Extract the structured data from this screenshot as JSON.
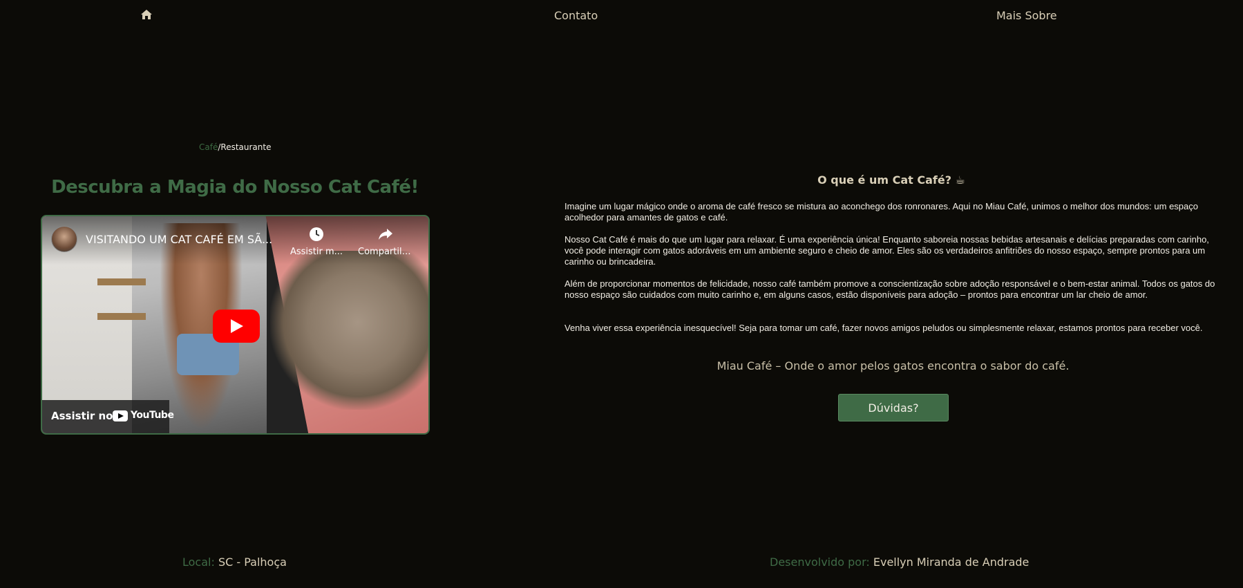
{
  "nav": {
    "home_icon": "home-icon",
    "contato": "Contato",
    "mais_sobre": "Mais Sobre"
  },
  "breadcrumb": {
    "part1": "Café",
    "separator": "/",
    "part2": "Restaurante"
  },
  "headline": "Descubra a Magia do Nosso Cat Café!",
  "video": {
    "title": "VISITANDO UM CAT CAFÉ EM SÃ...",
    "watch_later": "Assistir m...",
    "share": "Compartilh...",
    "watch_on": "Assistir no",
    "youtube": "YouTube"
  },
  "about": {
    "title": "O que é um Cat Café? ☕",
    "paragraphs": [
      "Imagine um lugar mágico onde o aroma de café fresco se mistura ao aconchego dos ronronares. Aqui no Miau Café, unimos o melhor dos mundos: um espaço acolhedor para amantes de gatos e café.",
      "Nosso Cat Café é mais do que um lugar para relaxar. É uma experiência única! Enquanto saboreia nossas bebidas artesanais e delícias preparadas com carinho, você pode interagir com gatos adoráveis em um ambiente seguro e cheio de amor. Eles são os verdadeiros anfitriões do nosso espaço, sempre prontos para um carinho ou brincadeira.",
      "Além de proporcionar momentos de felicidade, nosso café também promove a conscientização sobre adoção responsável e o bem-estar animal. Todos os gatos do nosso espaço são cuidados com muito carinho e, em alguns casos, estão disponíveis para adoção – prontos para encontrar um lar cheio de amor.",
      "Venha viver essa experiência inesquecível! Seja para tomar um café, fazer novos amigos peludos ou simplesmente relaxar, estamos prontos para receber você."
    ],
    "tagline": "Miau Café – Onde o amor pelos gatos encontra o sabor do café.",
    "button": "Dúvidas?"
  },
  "footer": {
    "local_label": "Local:",
    "local_value": "SC - Palhoça",
    "dev_label": "Desenvolvido por:",
    "dev_value": "Evellyn Miranda de Andrade"
  },
  "colors": {
    "background": "#0c0b07",
    "accent_green": "#3f6b46",
    "text_beige": "#d9cfb7",
    "youtube_red": "#ff0000"
  }
}
